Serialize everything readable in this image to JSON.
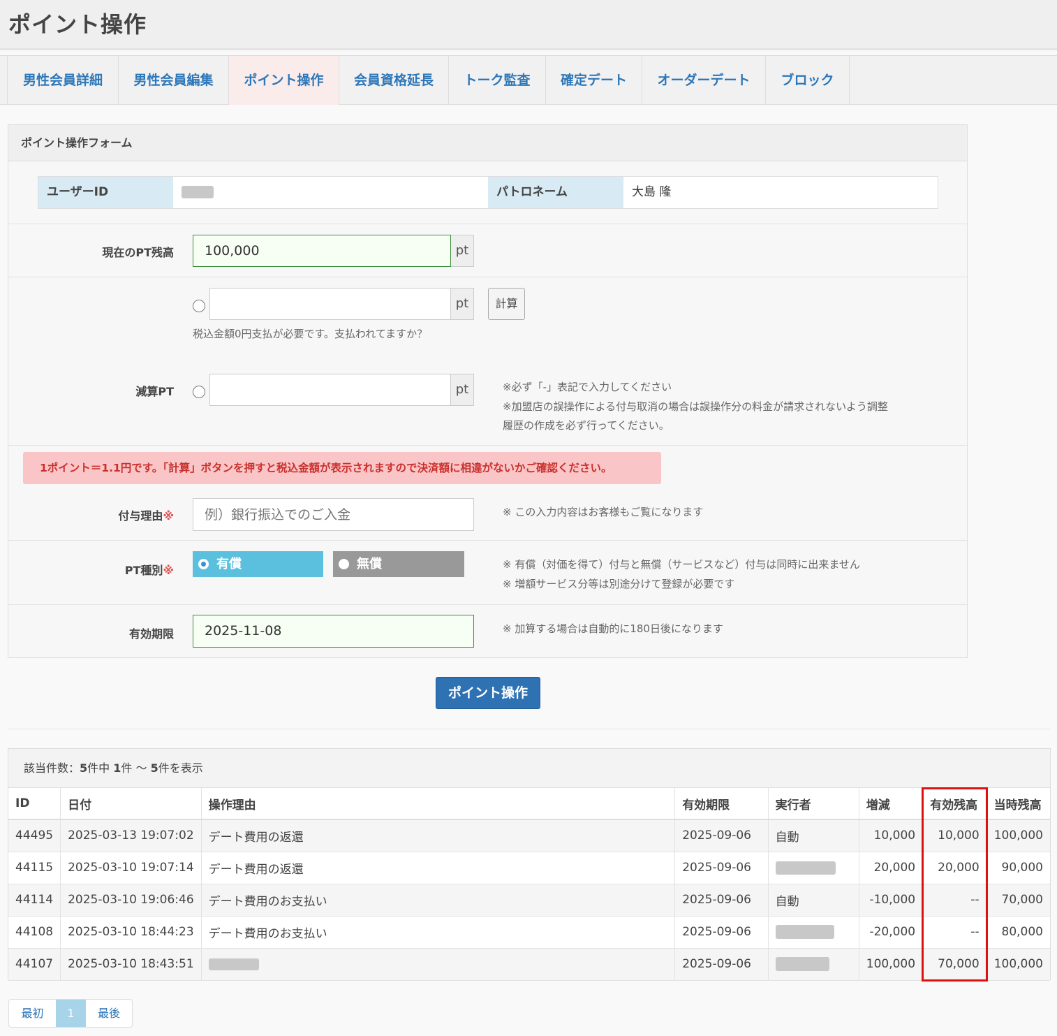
{
  "page": {
    "title": "ポイント操作"
  },
  "tabs": [
    {
      "label": "男性会員詳細"
    },
    {
      "label": "男性会員編集"
    },
    {
      "label": "ポイント操作"
    },
    {
      "label": "会員資格延長"
    },
    {
      "label": "トーク監査"
    },
    {
      "label": "確定デート"
    },
    {
      "label": "オーダーデート"
    },
    {
      "label": "ブロック"
    }
  ],
  "form": {
    "heading": "ポイント操作フォーム",
    "user_id_label": "ユーザーID",
    "patron_label": "パトロネーム",
    "patron_value": "大島 隆",
    "balance_label": "現在のPT残高",
    "balance_value": "100,000",
    "unit": "pt",
    "calc_button": "計算",
    "tax_note": "税込金額0円支払が必要です。支払われてますか？",
    "subtract_label": "減算PT",
    "subtract_note1": "※必ず「-」表記で入力してください",
    "subtract_note2": "※加盟店の誤操作による付与取消の場合は誤操作分の料金が請求されないよう調整",
    "subtract_note3": "履歴の作成を必ず行ってください。",
    "alert": "1ポイント＝1.1円です。「計算」ボタンを押すと税込金額が表示されますので決済額に相違がないかご確認ください。",
    "reason_label": "付与理由",
    "required_mark": "※",
    "reason_placeholder": "例）銀行振込でのご入金",
    "reason_note": "※ この入力内容はお客様もご覧になります",
    "ptype_label": "PT種別",
    "ptype_paid": "有償",
    "ptype_free": "無償",
    "ptype_note1": "※ 有償（対価を得て）付与と無償（サービスなど）付与は同時に出来ません",
    "ptype_note2": "※ 増額サービス分等は別途分けて登録が必要です",
    "expiry_label": "有効期限",
    "expiry_value": "2025-11-08",
    "expiry_note": "※ 加算する場合は自動的に180日後になります",
    "submit_button": "ポイント操作",
    "colors": {
      "accent": "#2f72b3",
      "paid": "#5bc0de",
      "free": "#999999",
      "alert_bg": "#f9c5c7"
    }
  },
  "history": {
    "count_prefix": "該当件数：",
    "total": "5",
    "count_mid1": "件中 ",
    "from": "1",
    "count_mid2": "件 〜 ",
    "to": "5",
    "count_suffix": "件を表示",
    "columns": [
      "ID",
      "日付",
      "操作理由",
      "有効期限",
      "実行者",
      "増減",
      "有効残高",
      "当時残高"
    ],
    "rows": [
      {
        "id": "44495",
        "date": "2025-03-13 19:07:02",
        "reason": "デート費用の返還",
        "expiry": "2025-09-06",
        "actor": "自動",
        "delta": "10,000",
        "valid": "10,000",
        "balance": "100,000"
      },
      {
        "id": "44115",
        "date": "2025-03-10 19:07:14",
        "reason": "デート費用の返還",
        "expiry": "2025-09-06",
        "actor": "",
        "delta": "20,000",
        "valid": "20,000",
        "balance": "90,000"
      },
      {
        "id": "44114",
        "date": "2025-03-10 19:06:46",
        "reason": "デート費用のお支払い",
        "expiry": "2025-09-06",
        "actor": "自動",
        "delta": "-10,000",
        "valid": "--",
        "balance": "70,000"
      },
      {
        "id": "44108",
        "date": "2025-03-10 18:44:23",
        "reason": "デート費用のお支払い",
        "expiry": "2025-09-06",
        "actor": "",
        "delta": "-20,000",
        "valid": "--",
        "balance": "80,000"
      },
      {
        "id": "44107",
        "date": "2025-03-10 18:43:51",
        "reason": "",
        "expiry": "2025-09-06",
        "actor": "",
        "delta": "100,000",
        "valid": "70,000",
        "balance": "100,000"
      }
    ]
  },
  "pager": {
    "first": "最初",
    "current": "1",
    "last": "最後"
  }
}
